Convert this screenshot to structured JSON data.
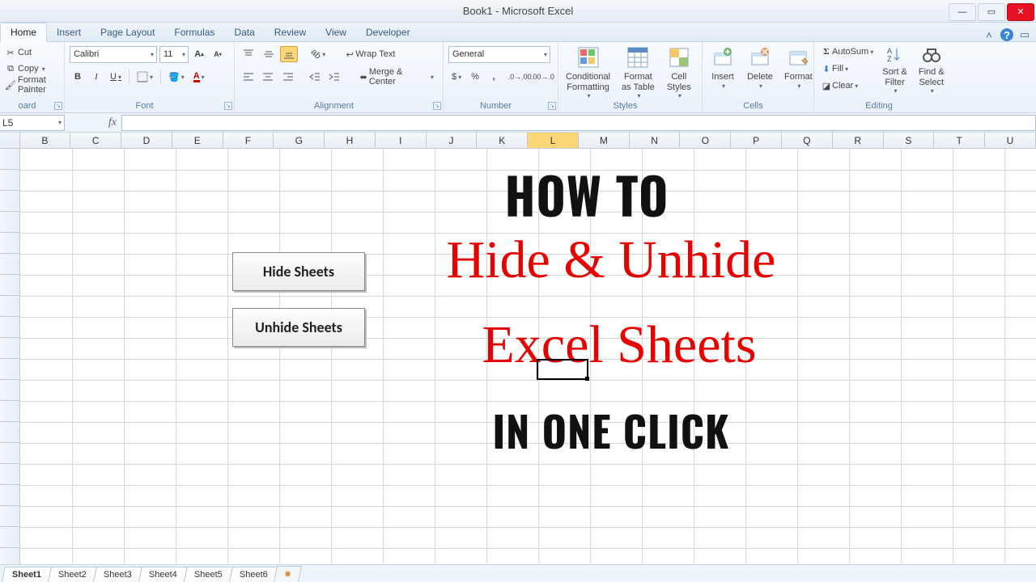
{
  "window": {
    "title": "Book1 - Microsoft Excel"
  },
  "tabs": {
    "items": [
      "Home",
      "Insert",
      "Page Layout",
      "Formulas",
      "Data",
      "Review",
      "View",
      "Developer"
    ],
    "active": "Home"
  },
  "clipboard": {
    "cut": "Cut",
    "copy": "Copy",
    "painter": "Format Painter",
    "group": "Clipboard"
  },
  "font": {
    "name": "Calibri",
    "size": "11",
    "group": "Font"
  },
  "alignment": {
    "wrap": "Wrap Text",
    "merge": "Merge & Center",
    "group": "Alignment"
  },
  "number": {
    "format": "General",
    "group": "Number"
  },
  "styles": {
    "cond": "Conditional Formatting",
    "table": "Format as Table",
    "cell": "Cell Styles",
    "group": "Styles"
  },
  "cells": {
    "insert": "Insert",
    "delete": "Delete",
    "format": "Format",
    "group": "Cells"
  },
  "editing": {
    "sum": "AutoSum",
    "fill": "Fill",
    "clear": "Clear",
    "sort": "Sort & Filter",
    "find": "Find & Select",
    "group": "Editing"
  },
  "namebox": "L5",
  "columns": [
    "B",
    "C",
    "D",
    "E",
    "F",
    "G",
    "H",
    "I",
    "J",
    "K",
    "L",
    "M",
    "N",
    "O",
    "P",
    "Q",
    "R",
    "S",
    "T",
    "U"
  ],
  "activeCol": "L",
  "macros": {
    "hide": "Hide Sheets",
    "unhide": "Unhide Sheets"
  },
  "headline": {
    "l1": "HOW TO",
    "l2": "Hide &  Unhide",
    "l3": "Excel Sheets",
    "l4": "IN ONE CLICK"
  },
  "sheets": [
    "Sheet1",
    "Sheet2",
    "Sheet3",
    "Sheet4",
    "Sheet5",
    "Sheet6"
  ],
  "activeSheet": "Sheet1"
}
